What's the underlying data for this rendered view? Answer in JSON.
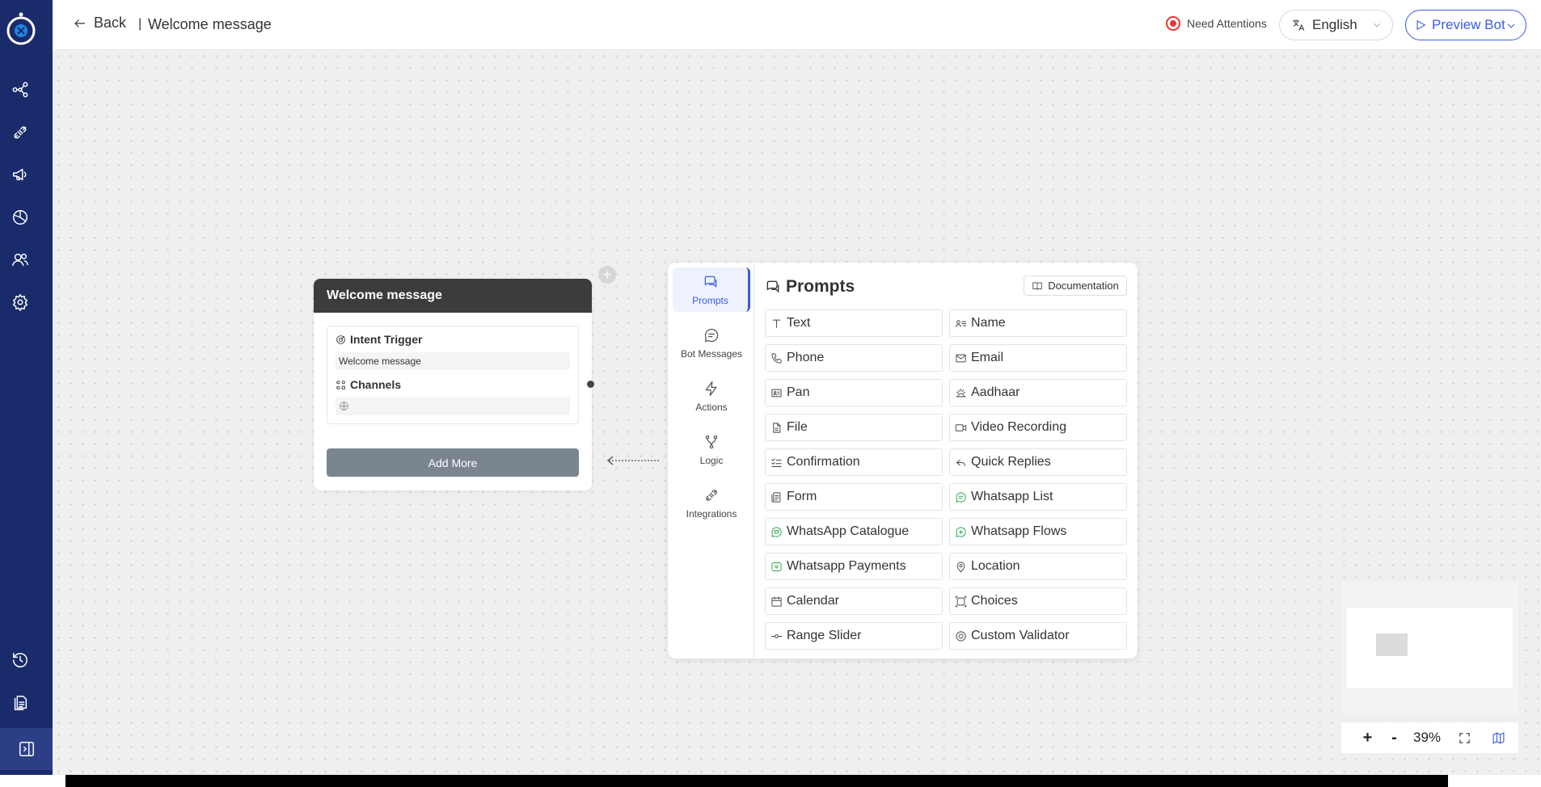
{
  "header": {
    "back_label": "Back",
    "separator": "|",
    "title": "Welcome message",
    "attention_label": "Need Attentions",
    "language": "English",
    "preview_label": "Preview Bot"
  },
  "sidebar": {
    "items": [
      {
        "name": "flow-icon"
      },
      {
        "name": "integration-plug-icon"
      },
      {
        "name": "broadcast-megaphone-icon"
      },
      {
        "name": "analytics-pie-icon"
      },
      {
        "name": "users-icon"
      },
      {
        "name": "settings-gear-icon"
      },
      {
        "name": "history-icon"
      },
      {
        "name": "documents-icon"
      },
      {
        "name": "collapse-sidebar-icon"
      }
    ]
  },
  "node": {
    "title": "Welcome message",
    "intent_label": "Intent Trigger",
    "intent_value": "Welcome message",
    "channels_label": "Channels",
    "add_more_label": "Add More"
  },
  "panel": {
    "nav": [
      {
        "label": "Prompts",
        "icon": "chat-icon",
        "active": true
      },
      {
        "label": "Bot Messages",
        "icon": "message-icon",
        "active": false
      },
      {
        "label": "Actions",
        "icon": "lightning-icon",
        "active": false
      },
      {
        "label": "Logic",
        "icon": "branch-icon",
        "active": false
      },
      {
        "label": "Integrations",
        "icon": "plug-icon",
        "active": false
      }
    ],
    "title": "Prompts",
    "documentation_label": "Documentation",
    "items": [
      {
        "label": "Text",
        "icon": "text-icon"
      },
      {
        "label": "Name",
        "icon": "name-card-icon"
      },
      {
        "label": "Phone",
        "icon": "phone-icon"
      },
      {
        "label": "Email",
        "icon": "email-icon"
      },
      {
        "label": "Pan",
        "icon": "id-card-icon"
      },
      {
        "label": "Aadhaar",
        "icon": "aadhaar-icon"
      },
      {
        "label": "File",
        "icon": "file-icon"
      },
      {
        "label": "Video Recording",
        "icon": "video-icon"
      },
      {
        "label": "Confirmation",
        "icon": "checklist-icon"
      },
      {
        "label": "Quick Replies",
        "icon": "reply-icon"
      },
      {
        "label": "Form",
        "icon": "form-icon"
      },
      {
        "label": "Whatsapp List",
        "icon": "whatsapp-icon"
      },
      {
        "label": "WhatsApp Catalogue",
        "icon": "whatsapp-icon"
      },
      {
        "label": "Whatsapp Flows",
        "icon": "whatsapp-icon"
      },
      {
        "label": "Whatsapp Payments",
        "icon": "whatsapp-payments-icon"
      },
      {
        "label": "Location",
        "icon": "location-pin-icon"
      },
      {
        "label": "Calendar",
        "icon": "calendar-icon"
      },
      {
        "label": "Choices",
        "icon": "choices-icon"
      },
      {
        "label": "Range Slider",
        "icon": "slider-icon"
      },
      {
        "label": "Custom Validator",
        "icon": "validator-icon"
      }
    ]
  },
  "zoom": {
    "zoom_in": "+",
    "zoom_out": "-",
    "level": "39%"
  },
  "colors": {
    "sidebar": "#1a2b6b",
    "accent": "#3b5bdb",
    "node_header": "#3c3c3c",
    "whatsapp": "#25a244",
    "attention": "#e53935"
  }
}
